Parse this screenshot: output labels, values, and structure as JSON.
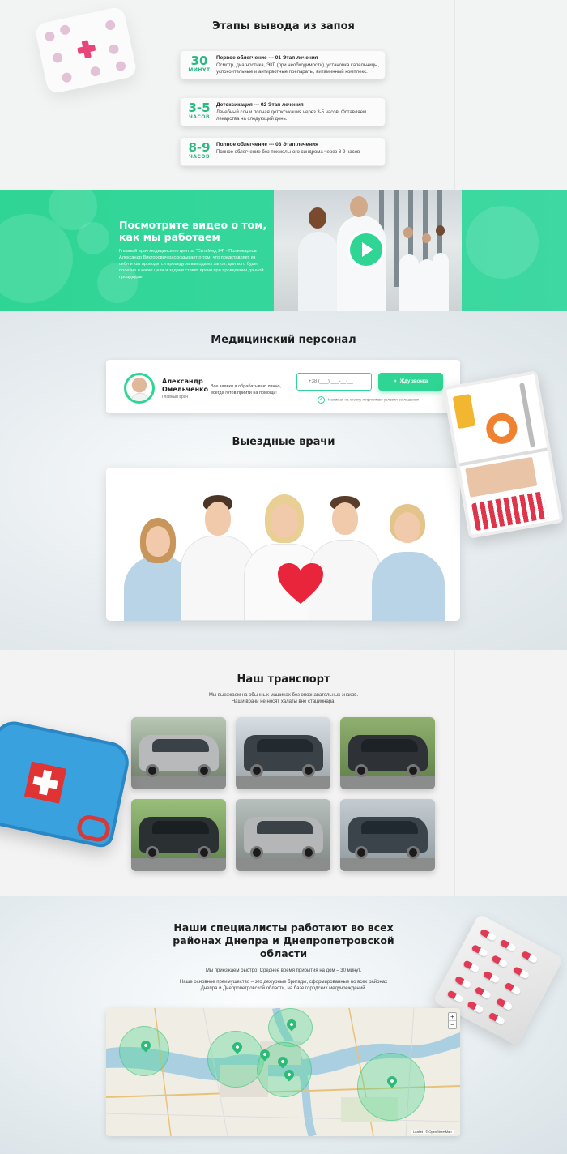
{
  "stages": {
    "title": "Этапы вывода из запоя",
    "items": [
      {
        "num": "30",
        "unit": "МИНУТ",
        "title": "Первое облегчение --- 01 Этап лечения",
        "desc": "Осмотр, диагностика, ЭКГ (при необходимости), установка капельницы, успокоительные и антирвотные препараты, витаминный комплекс."
      },
      {
        "num": "3-5",
        "unit": "ЧАСОВ",
        "title": "Детоксикация --- 02 Этап лечения",
        "desc": "Лечебный сон и полная детоксикация через 3-5 часов. Оставляем лекарства на следующий день."
      },
      {
        "num": "8-9",
        "unit": "ЧАСОВ",
        "title": "Полное облегчение --- 03 Этап лечения",
        "desc": "Полное облегчение без похмельного синдрома через 8-9 часов"
      }
    ]
  },
  "video": {
    "title": "Посмотрите видео о том, как мы работаем",
    "desc": "Главный врач медицинского центра \"СитиМед 24\" - Полиокарпов Александр Викторович рассказывает о том, что представляет из себя и как проводится процедура вывода из запоя, для кого будет полезна и какие цели и задачи ставят врачи при проведении данной процедуры."
  },
  "staff": {
    "title": "Медицинский персонал",
    "doctor_name": "Александр Омельченко",
    "doctor_role": "Главный врач",
    "doctor_text": "Все заявки я обрабатываю лично, всегда готов прийти на помощь!",
    "phone_placeholder": "+38 (___) ___-__-__",
    "call_button": "Жду звонка",
    "consent": "Нажимая на кнопку, я принимаю условия соглашения"
  },
  "field_doctors": {
    "title": "Выездные врачи"
  },
  "transport": {
    "title": "Наш транспорт",
    "sub1": "Мы выезжаем на обычных машинах без опознавательных знаков.",
    "sub2": "Наши врачи не носят халаты вне стационара."
  },
  "regions": {
    "title1": "Наши специалисты работают во всех",
    "title2": "районах Днепра и Днепропетровской",
    "title3": "области",
    "sub1": "Мы приезжаем быстро! Среднее время прибытия на дом – 30 минут.",
    "sub2": "Наше основное преимущество – это дежурные бригады, сформированные во всех районах",
    "sub3": "Днепра и Днепропетровской области, на базе городских медучреждений.",
    "zoom_in": "+",
    "zoom_out": "−",
    "attribution": "Leaflet | © OpenStreetMap"
  },
  "colors": {
    "accent": "#2fd594",
    "accent_text": "#2bb982",
    "title": "#1e1e1e"
  }
}
